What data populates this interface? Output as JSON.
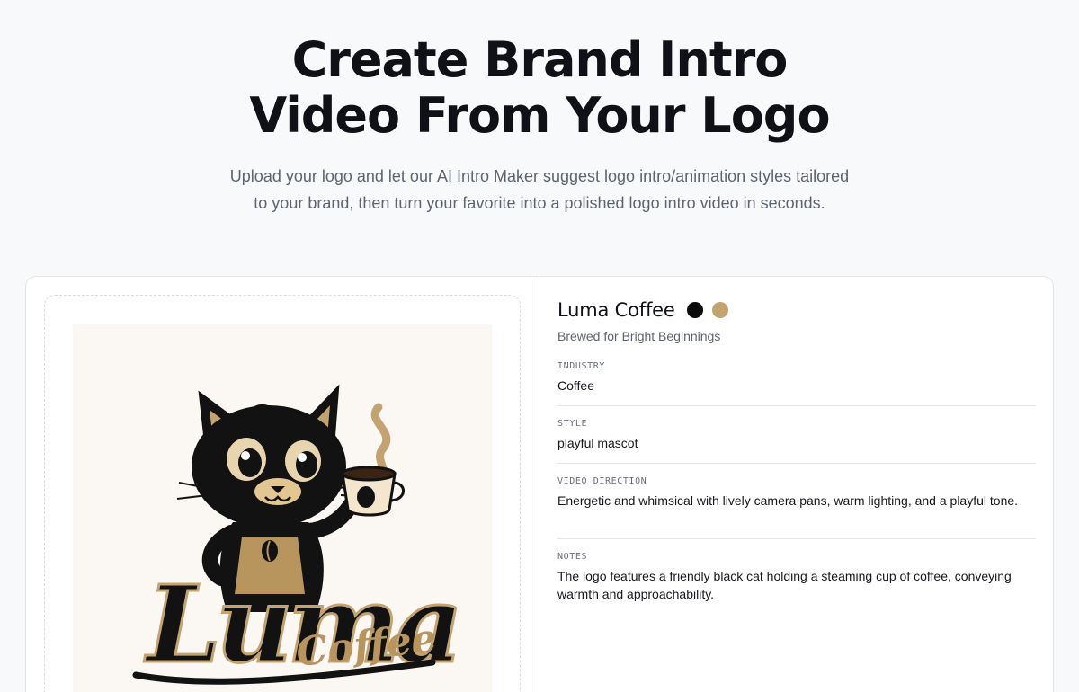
{
  "hero": {
    "title_line1": "Create Brand Intro",
    "title_line2": "Video From Your Logo",
    "subtitle": "Upload your logo and let our AI Intro Maker suggest logo intro/animation styles tailored to your brand, then turn your favorite into a polished logo intro video in seconds."
  },
  "logo_preview": {
    "alt": "Luma Coffee logo",
    "wordmark_main": "Luma",
    "wordmark_sub": "Coffee"
  },
  "brand": {
    "name": "Luma Coffee",
    "tagline": "Brewed for Bright Beginnings",
    "colors": [
      "#0b0b0c",
      "#c3a36f"
    ]
  },
  "fields": [
    {
      "label": "INDUSTRY",
      "value": "Coffee"
    },
    {
      "label": "STYLE",
      "value": "playful mascot"
    },
    {
      "label": "VIDEO DIRECTION",
      "value": "Energetic and whimsical with lively camera pans, warm lighting, and a playful tone."
    },
    {
      "label": "NOTES",
      "value": "The logo features a friendly black cat holding a steaming cup of coffee, conveying warmth and approachability."
    }
  ]
}
